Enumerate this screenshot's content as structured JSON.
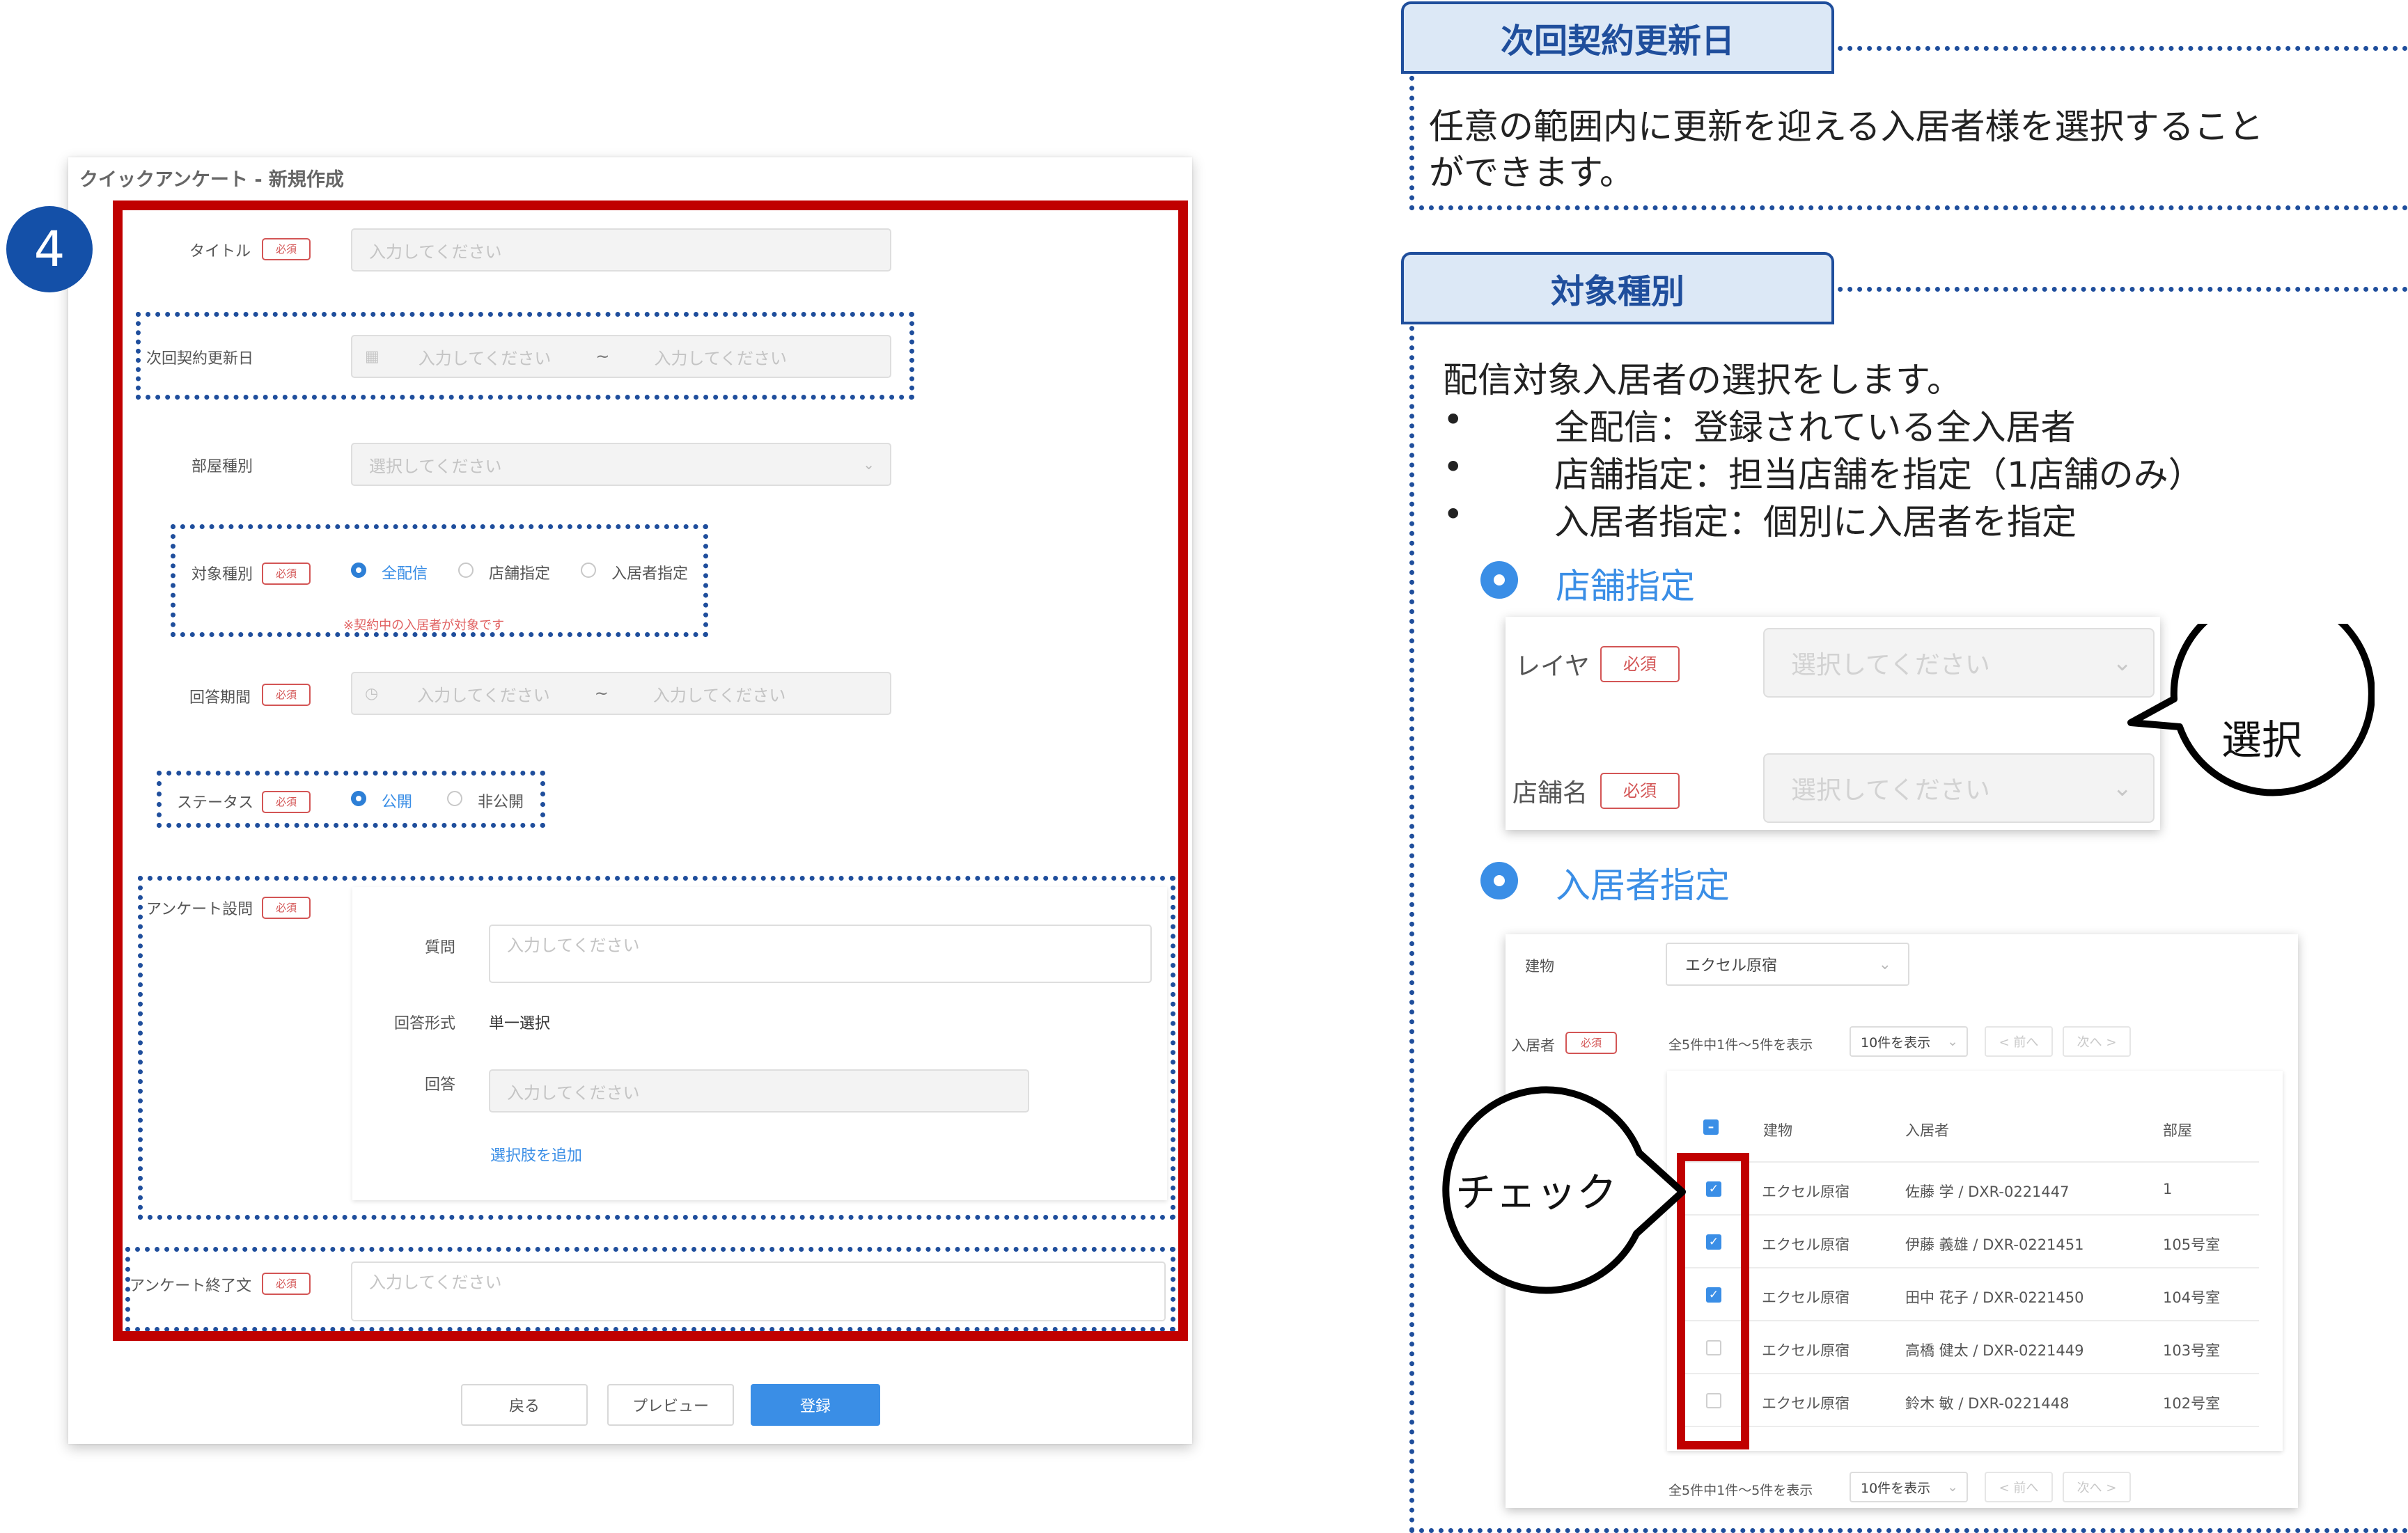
{
  "form": {
    "title": "クイックアンケート - 新規作成",
    "step": "4",
    "required_badge": "必須",
    "placeholder": "入力してください",
    "select_placeholder": "選択してください",
    "range_separator": "~",
    "fields": {
      "title_label": "タイトル",
      "renewal_label": "次回契約更新日",
      "room_type_label": "部屋種別",
      "target_label": "対象種別",
      "target_options": [
        "全配信",
        "店舗指定",
        "入居者指定"
      ],
      "target_note": "※契約中の入居者が対象です",
      "period_label": "回答期間",
      "status_label": "ステータス",
      "status_options": [
        "公開",
        "非公開"
      ],
      "survey_label": "アンケート設問",
      "question_label": "質問",
      "answer_format_label": "回答形式",
      "answer_format_value": "単一選択",
      "answer_label": "回答",
      "add_choice_link": "選択肢を追加",
      "end_text_label": "アンケート終了文"
    },
    "buttons": {
      "back": "戻る",
      "preview": "プレビュー",
      "register": "登録"
    }
  },
  "renewal_panel": {
    "title": "次回契約更新日",
    "body_line1": "任意の範囲内に更新を迎える入居者様を選択すること",
    "body_line2": "ができます。"
  },
  "target_panel": {
    "title": "対象種別",
    "intro": "配信対象入居者の選択をします。",
    "bullets": [
      "全配信：登録されている全入居者",
      "店舗指定：担当店舗を指定（1店舗のみ）",
      "入居者指定：個別に入居者を指定"
    ],
    "store_option": "店舗指定",
    "store_card": {
      "layer_label": "レイヤ",
      "store_label": "店舗名",
      "required": "必須",
      "placeholder": "選択してください",
      "bubble": "選択"
    },
    "resident_option": "入居者指定",
    "resident_card": {
      "building_label": "建物",
      "building_value": "エクセル原宿",
      "resident_label": "入居者",
      "required": "必須",
      "count_text": "全5件中1件〜5件を表示",
      "per_page": "10件を表示",
      "prev": "< 前へ",
      "next": "次へ >",
      "columns": [
        "建物",
        "入居者",
        "部屋"
      ],
      "rows": [
        {
          "building": "エクセル原宿",
          "resident": "佐藤 学 / DXR-0221447",
          "room": "1",
          "checked": true
        },
        {
          "building": "エクセル原宿",
          "resident": "伊藤 義雄 / DXR-0221451",
          "room": "105号室",
          "checked": true
        },
        {
          "building": "エクセル原宿",
          "resident": "田中 花子 / DXR-0221450",
          "room": "104号室",
          "checked": true
        },
        {
          "building": "エクセル原宿",
          "resident": "高橋 健太 / DXR-0221449",
          "room": "103号室",
          "checked": false
        },
        {
          "building": "エクセル原宿",
          "resident": "鈴木 敏 / DXR-0221448",
          "room": "102号室",
          "checked": false
        }
      ],
      "bubble": "チェック"
    }
  },
  "colors": {
    "accent_red": "#c00000",
    "dotted_blue": "#1f4e9c",
    "primary_blue": "#3a8ee6",
    "step_blue": "#1450a8"
  }
}
